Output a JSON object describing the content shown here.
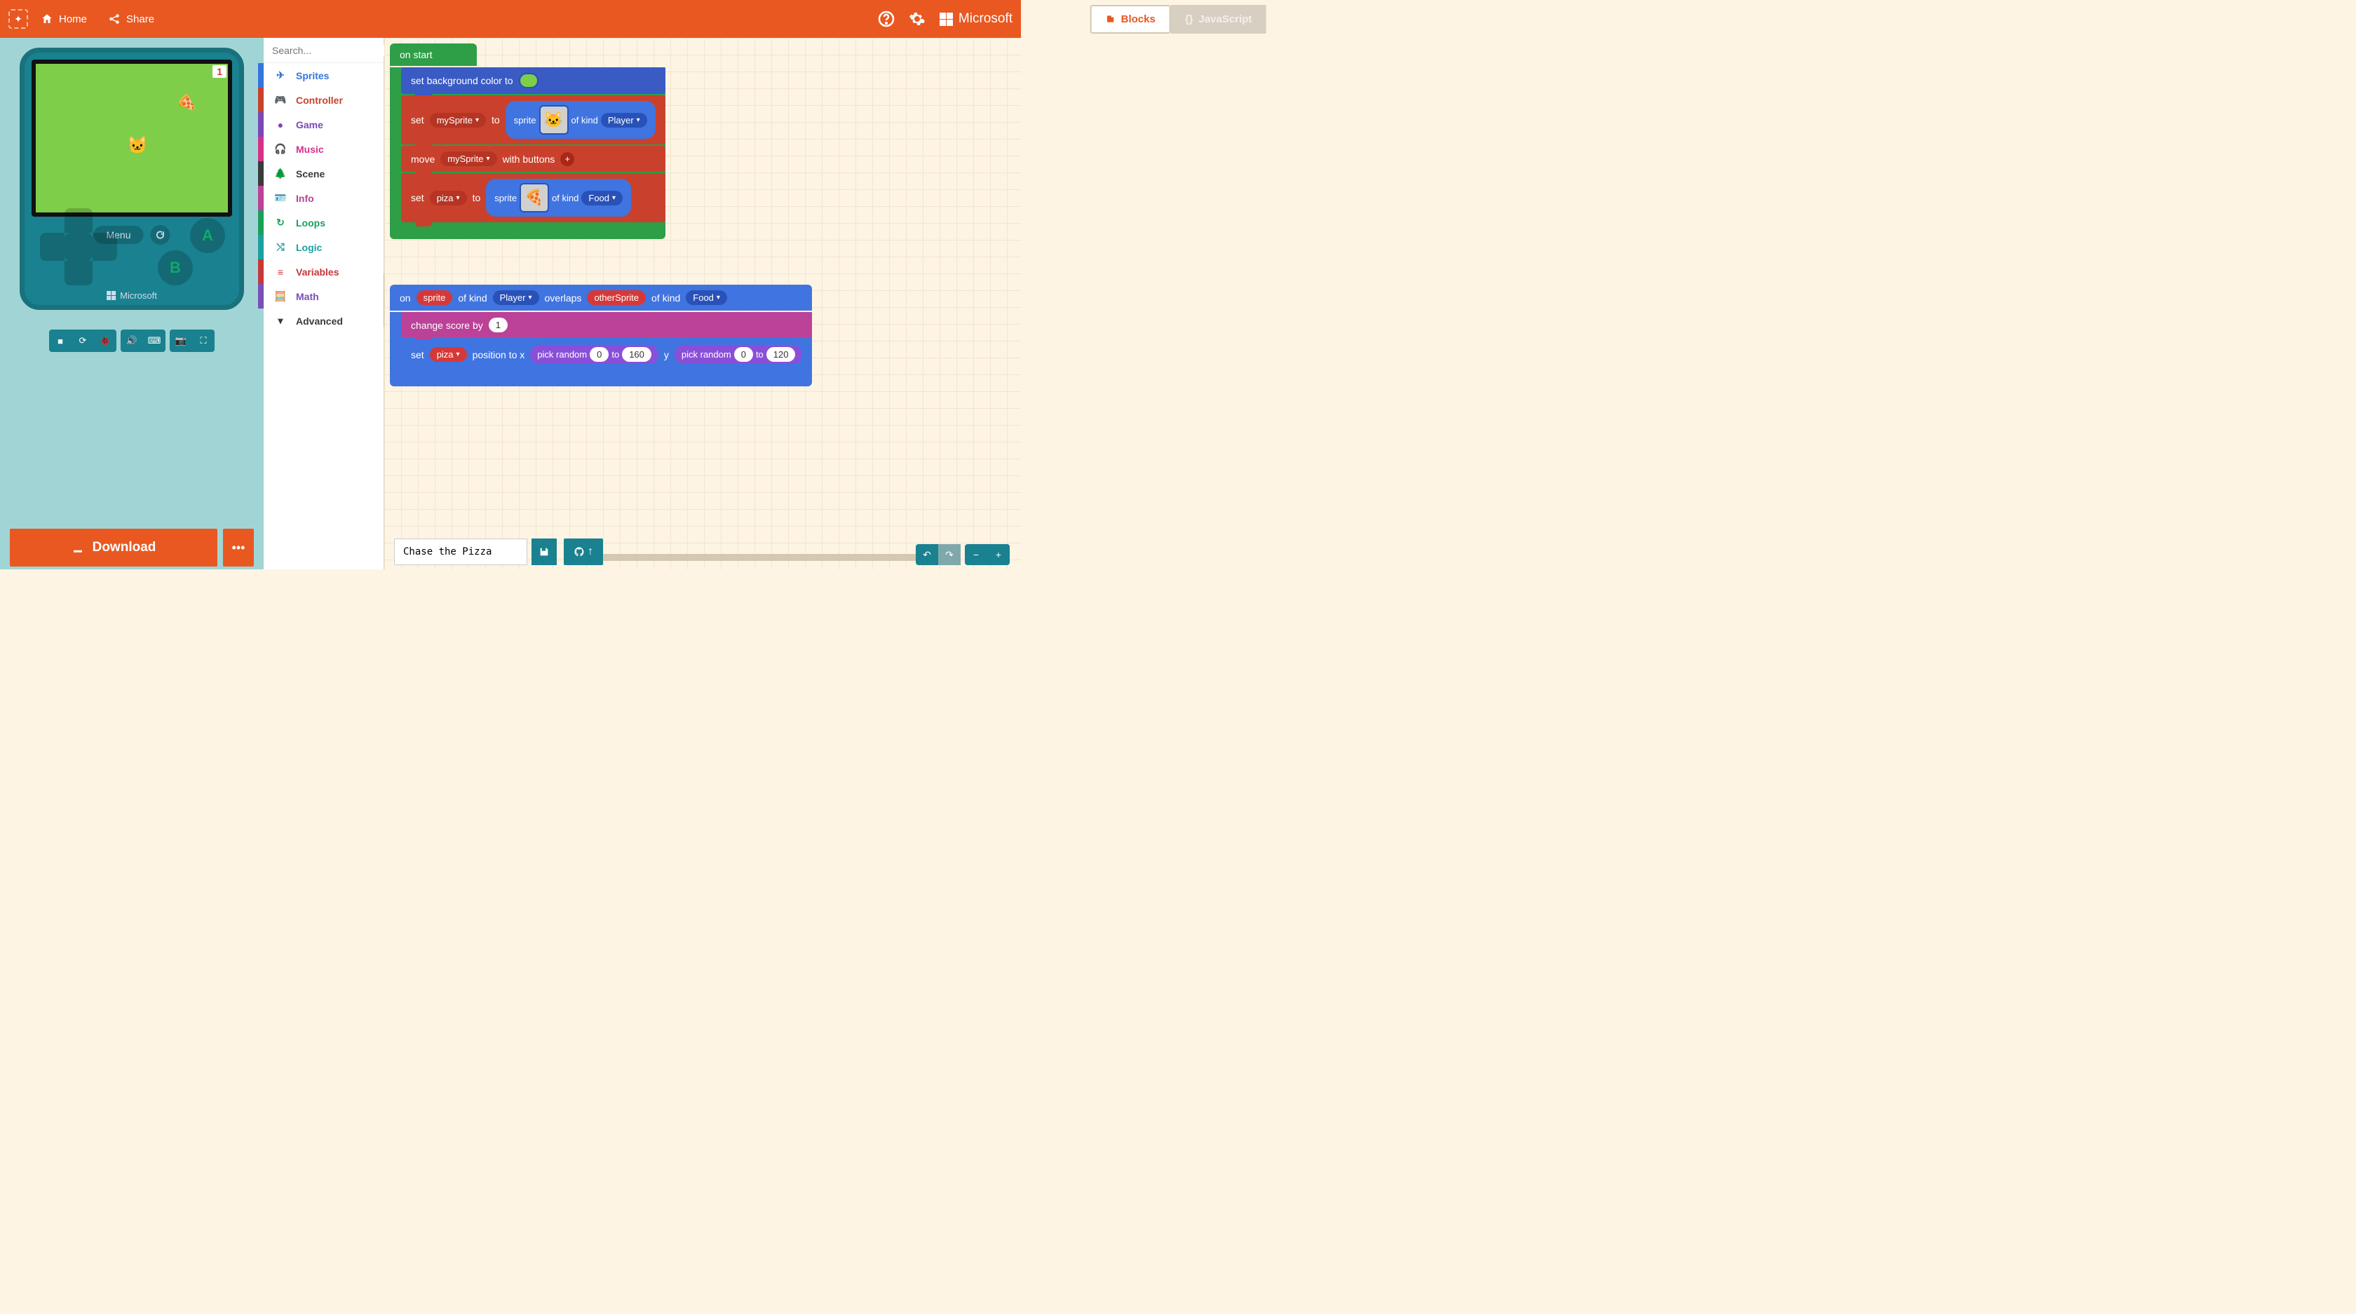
{
  "header": {
    "home": "Home",
    "share": "Share",
    "blocks_tab": "Blocks",
    "js_tab": "JavaScript",
    "brand": "Microsoft"
  },
  "simulator": {
    "score": "1",
    "menu_label": "Menu",
    "button_a": "A",
    "button_b": "B",
    "brand": "Microsoft"
  },
  "download": {
    "label": "Download"
  },
  "toolbox": {
    "search_placeholder": "Search...",
    "categories": {
      "sprites": "Sprites",
      "controller": "Controller",
      "game": "Game",
      "music": "Music",
      "scene": "Scene",
      "info": "Info",
      "loops": "Loops",
      "logic": "Logic",
      "variables": "Variables",
      "math": "Math",
      "advanced": "Advanced"
    }
  },
  "blocks": {
    "on_start": "on start",
    "set_bg": "set background color to",
    "set": "set",
    "to": "to",
    "sprite": "sprite",
    "of_kind": "of kind",
    "mySprite": "mySprite",
    "player": "Player",
    "move": "move",
    "with_buttons": "with buttons",
    "piza": "piza",
    "food": "Food",
    "on": "on",
    "sprite_lbl": "sprite",
    "overlaps": "overlaps",
    "otherSprite": "otherSprite",
    "change_score_by": "change score by",
    "score_delta": "1",
    "position_to_x": "position to x",
    "pick_random": "pick random",
    "rx_min": "0",
    "rx_max": "160",
    "y_lbl": "y",
    "ry_min": "0",
    "ry_max": "120"
  },
  "project": {
    "name": "Chase the Pizza"
  }
}
